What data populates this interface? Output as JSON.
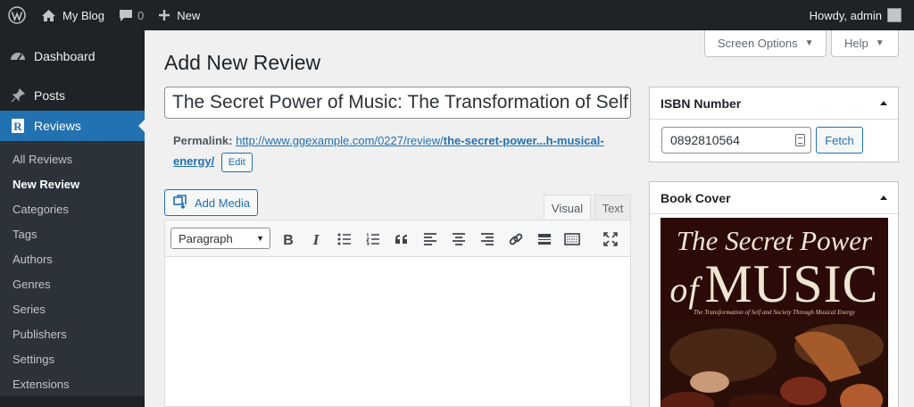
{
  "adminbar": {
    "site_name": "My Blog",
    "comments_count": "0",
    "new_label": "New",
    "howdy": "Howdy, admin"
  },
  "sidebar": {
    "dashboard": "Dashboard",
    "posts": "Posts",
    "reviews": "Reviews",
    "submenu": [
      "All Reviews",
      "New Review",
      "Categories",
      "Tags",
      "Authors",
      "Genres",
      "Series",
      "Publishers",
      "Settings",
      "Extensions"
    ]
  },
  "screen_options": "Screen Options",
  "help": "Help",
  "page_title": "Add New Review",
  "post_title": "The Secret Power of Music: The Transformation of Self and Society Through Musical Energy",
  "permalink": {
    "label": "Permalink:",
    "url_base": "http://www.ggexample.com/0227/review/",
    "slug_start": "the-secret-power...h-musical-",
    "slug_end": "energy/",
    "edit": "Edit"
  },
  "editor": {
    "add_media": "Add Media",
    "tab_visual": "Visual",
    "tab_text": "Text",
    "format": "Paragraph"
  },
  "isbn_box": {
    "title": "ISBN Number",
    "value": "0892810564",
    "fetch": "Fetch"
  },
  "cover_box": {
    "title": "Book Cover",
    "cover_line1": "The Secret Power",
    "cover_of": "of",
    "cover_line2": "MUSIC",
    "cover_subtitle": "The Transformation of Self and Society Through Musical Energy"
  },
  "colors": {
    "accent": "#2271b1",
    "adminbar": "#1d2327",
    "background": "#f0f0f1"
  },
  "icons": [
    "wordpress-logo-icon",
    "home-icon",
    "comment-icon",
    "plus-icon",
    "dashboard-icon",
    "pin-icon",
    "reviews-icon",
    "media-icon",
    "bold-icon",
    "italic-icon",
    "bullet-list-icon",
    "numbered-list-icon",
    "quote-icon",
    "align-left-icon",
    "align-center-icon",
    "align-right-icon",
    "link-icon",
    "read-more-icon",
    "toolbar-toggle-icon",
    "fullscreen-icon"
  ]
}
